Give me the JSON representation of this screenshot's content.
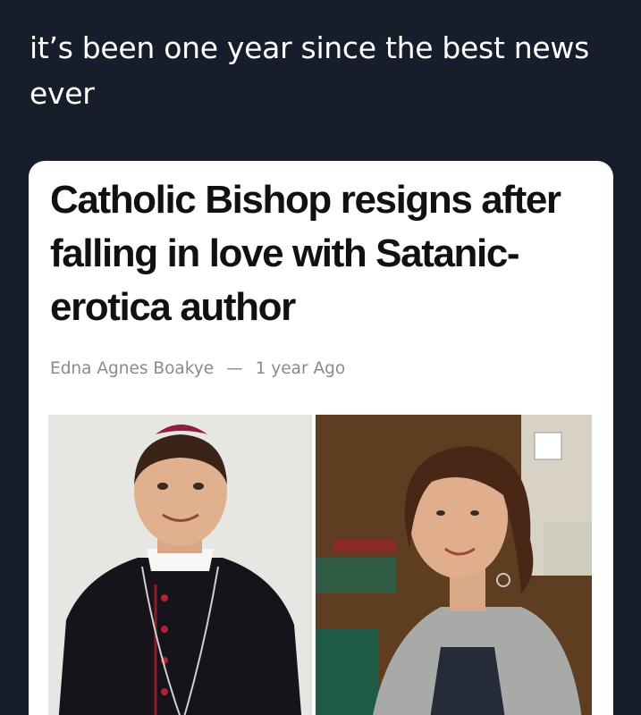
{
  "tweet": {
    "text": "it’s been one year since the best news ever"
  },
  "article": {
    "headline": "Catholic Bishop resigns after falling in love with Satanic-erotica author",
    "author": "Edna Agnes Boakye",
    "separator": "—",
    "time": "1 year Ago"
  }
}
